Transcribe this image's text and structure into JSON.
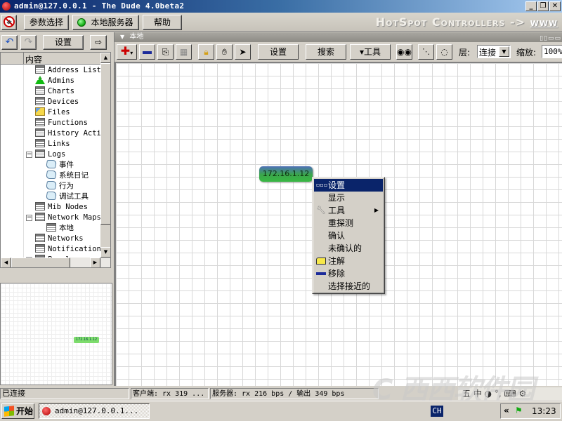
{
  "window": {
    "title": "admin@127.0.0.1 - The Dude 4.0beta2",
    "controls": {
      "minimize": "_",
      "restore": "❐",
      "close": "✕"
    }
  },
  "menubar": {
    "disconnect_icon": "disconnect-icon",
    "items": [
      "参数选择",
      "本地服务器",
      "帮助"
    ],
    "server_status_color": "#22cc22",
    "banner_text": "HotSpot Controllers -> ",
    "banner_link": "www"
  },
  "left_toolbar": {
    "undo_icon": "undo-icon",
    "redo_icon": "redo-icon",
    "settings_label": "设置",
    "export_icon": "export-icon"
  },
  "tree": {
    "header": "内容",
    "items": [
      {
        "label": "Address List",
        "icon": "table-icon",
        "indent": 1
      },
      {
        "label": "Admins",
        "icon": "admin-icon",
        "indent": 1
      },
      {
        "label": "Charts",
        "icon": "table-icon",
        "indent": 1
      },
      {
        "label": "Devices",
        "icon": "table-icon",
        "indent": 1
      },
      {
        "label": "Files",
        "icon": "folder-icon",
        "indent": 1
      },
      {
        "label": "Functions",
        "icon": "table-icon",
        "indent": 1
      },
      {
        "label": "History Acti",
        "icon": "table-icon",
        "indent": 1
      },
      {
        "label": "Links",
        "icon": "table-icon",
        "indent": 1
      },
      {
        "label": "Logs",
        "icon": "table-icon",
        "indent": 1,
        "expanded": true
      },
      {
        "label": "事件",
        "icon": "log-icon",
        "indent": 2
      },
      {
        "label": "系统日记",
        "icon": "log-icon",
        "indent": 2
      },
      {
        "label": "行为",
        "icon": "log-icon",
        "indent": 2
      },
      {
        "label": "调试工具",
        "icon": "log-icon",
        "indent": 2
      },
      {
        "label": "Mib Nodes",
        "icon": "table-icon",
        "indent": 1
      },
      {
        "label": "Network Maps",
        "icon": "table-icon",
        "indent": 1,
        "expanded": true
      },
      {
        "label": "本地",
        "icon": "table-icon",
        "indent": 2
      },
      {
        "label": "Networks",
        "icon": "table-icon",
        "indent": 1
      },
      {
        "label": "Notification",
        "icon": "table-icon",
        "indent": 1
      },
      {
        "label": "Panels",
        "icon": "table-icon",
        "indent": 1,
        "expanded": true
      }
    ]
  },
  "minimap": {
    "node_label": "172.16.1.12"
  },
  "map": {
    "panel_title": "本地",
    "toolbar": {
      "add_icon": "add-icon",
      "remove_icon": "remove-icon",
      "copy_icon": "copy-icon",
      "paste_icon": "paste-icon",
      "lock_icon": "lock-icon",
      "hand_icon": "hand-icon",
      "pointer_icon": "pointer-icon",
      "settings_label": "设置",
      "search_label": "搜索",
      "tools_label": "▾工具",
      "find_icon": "binoculars-icon",
      "layer_label": "层:",
      "layer_value": "连接",
      "zoom_label": "缩放:",
      "zoom_value": "100%"
    },
    "node": {
      "label": "172.16.1.12"
    }
  },
  "context_menu": {
    "items": [
      {
        "label": "设置",
        "icon": "dots-icon",
        "selected": true
      },
      {
        "label": "显示"
      },
      {
        "label": "工具",
        "icon": "tools-icon",
        "submenu": true
      },
      {
        "label": "重探测"
      },
      {
        "label": "确认"
      },
      {
        "label": "未确认的"
      },
      {
        "label": "注解",
        "icon": "note-icon"
      },
      {
        "label": "移除",
        "icon": "remove-icon"
      },
      {
        "label": "选择接近的"
      }
    ]
  },
  "statusbar": {
    "connection": "已连接",
    "client": "客户端: rx 319 ...",
    "server": "服务器: rx 216 bps / 输出 349 bps"
  },
  "taskbar": {
    "start_label": "开始",
    "task_label": "admin@127.0.0.1...",
    "lang": "CH",
    "ime": "五 中 ◑ °, ⌨ ⚙",
    "tray_arrow": "«",
    "clock": "13:23"
  }
}
